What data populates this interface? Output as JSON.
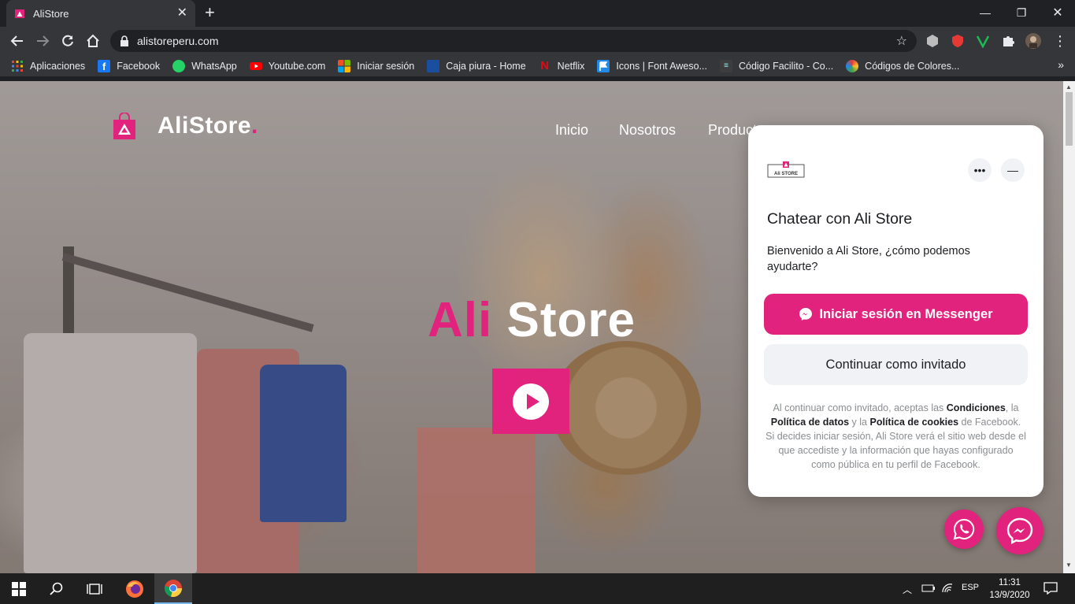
{
  "browser": {
    "tab_title": "AliStore",
    "url": "alistoreperu.com",
    "bookmarks": [
      {
        "label": "Aplicaciones",
        "icon": "apps-grid-icon",
        "color": "#4285f4"
      },
      {
        "label": "Facebook",
        "icon": "facebook-icon",
        "color": "#1877f2"
      },
      {
        "label": "WhatsApp",
        "icon": "whatsapp-icon",
        "color": "#25d366"
      },
      {
        "label": "Youtube.com",
        "icon": "youtube-icon",
        "color": "#ff0000"
      },
      {
        "label": "Iniciar sesión",
        "icon": "microsoft-icon",
        "color": "#f25022"
      },
      {
        "label": "Caja piura - Home",
        "icon": "caja-piura-icon",
        "color": "#1a4fa0"
      },
      {
        "label": "Netflix",
        "icon": "netflix-icon",
        "color": "#e50914"
      },
      {
        "label": "Icons | Font Aweso...",
        "icon": "flag-icon",
        "color": "#228ae6"
      },
      {
        "label": "Código Facilito - Co...",
        "icon": "codigo-facilito-icon",
        "color": "#3d3d3d"
      },
      {
        "label": "Códigos de Colores...",
        "icon": "color-wheel-icon",
        "color": "#e53935"
      }
    ],
    "bookmarks_more": "»"
  },
  "site": {
    "brand": "AliStore",
    "brand_dot": ".",
    "nav": [
      "Inicio",
      "Nosotros",
      "Productos"
    ],
    "hero_part1": "Ali",
    "hero_part2": "Store",
    "accent_color": "#e2237d"
  },
  "chat": {
    "title": "Chatear con Ali Store",
    "welcome": "Bienvenido a Ali Store, ¿cómo podemos ayudarte?",
    "login_button": "Iniciar sesión en Messenger",
    "guest_button": "Continuar como invitado",
    "legal": {
      "t1": "Al continuar como invitado, aceptas las ",
      "conditions": "Condiciones",
      "t2": ", la ",
      "data_policy": "Política de datos",
      "t3": " y la ",
      "cookies_policy": "Política de cookies",
      "t4": " de Facebook. Si decides iniciar sesión, Ali Store verá el sitio web desde el que accediste y la información que hayas configurado como pública en tu perfil de Facebook."
    },
    "more_icon": "•••",
    "minimize_icon": "—"
  },
  "taskbar": {
    "language": "ESP",
    "time": "11:31",
    "date": "13/9/2020"
  }
}
